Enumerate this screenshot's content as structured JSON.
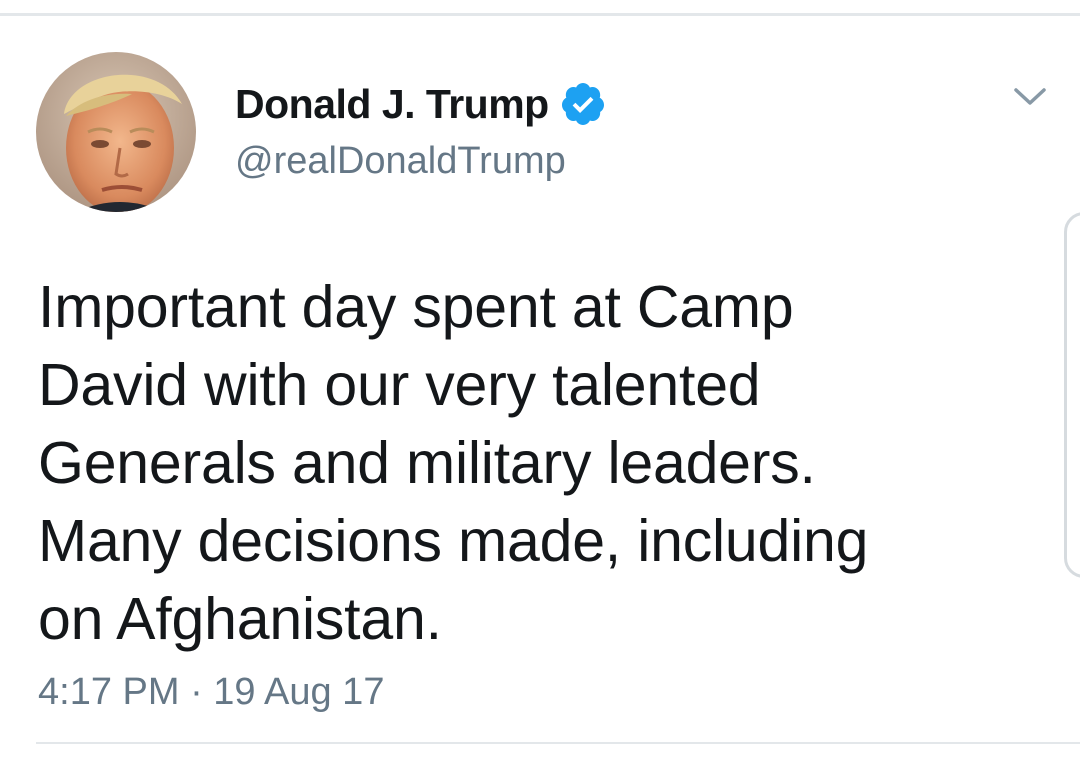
{
  "tweet": {
    "author": {
      "display_name": "Donald J. Trump",
      "handle": "@realDonaldTrump",
      "verified": true,
      "avatar_icon": "profile-photo",
      "verified_icon": "verified-badge-icon"
    },
    "menu_icon": "chevron-down-icon",
    "text_lines": [
      "Important day spent at Camp",
      "David with our very talented",
      "Generals and military leaders.",
      "Many decisions made, including",
      "on Afghanistan."
    ],
    "timestamp": "4:17 PM · 19 Aug 17"
  },
  "colors": {
    "text_primary": "#14171a",
    "text_secondary": "#657786",
    "verified_blue": "#1da1f2",
    "divider": "#e3e7ea"
  }
}
